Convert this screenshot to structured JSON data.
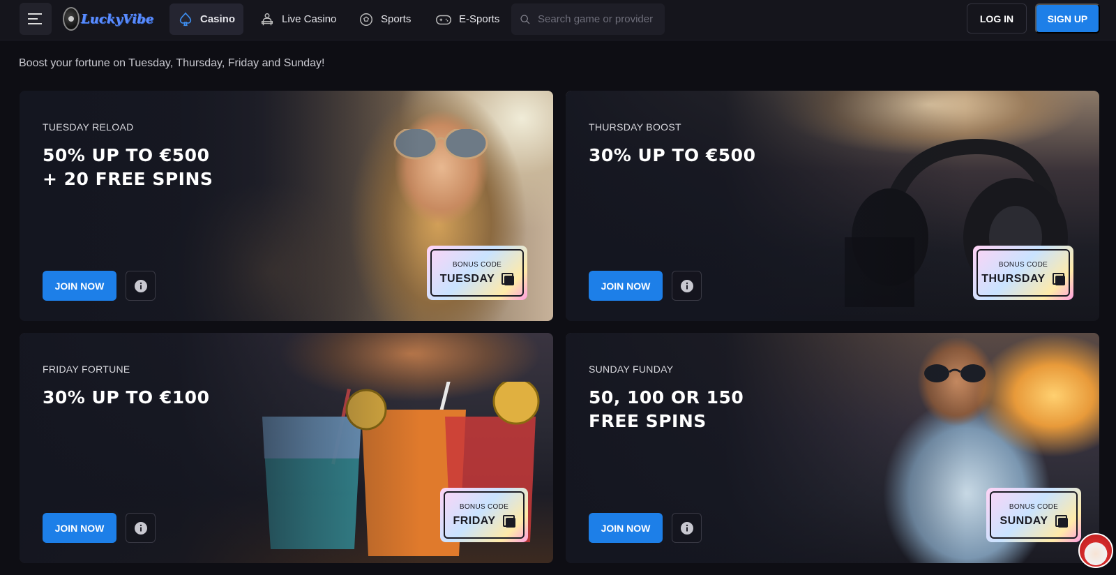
{
  "header": {
    "logo_text_a": "Lucky",
    "logo_text_b": "Vibe",
    "nav": [
      {
        "label": "Casino",
        "icon": "spade-icon",
        "active": true
      },
      {
        "label": "Live Casino",
        "icon": "dealer-icon",
        "active": false
      },
      {
        "label": "Sports",
        "icon": "soccer-ball-icon",
        "active": false
      },
      {
        "label": "E-Sports",
        "icon": "gamepad-icon",
        "active": false
      }
    ],
    "search_placeholder": "Search game or provider",
    "login_label": "LOG IN",
    "signup_label": "SIGN UP"
  },
  "subtitle": "Boost your fortune on Tuesday, Thursday, Friday and Sunday!",
  "promotions": [
    {
      "label": "TUESDAY RELOAD",
      "title_line1": "50% UP TO €500",
      "title_line2": "+ 20 FREE SPINS",
      "join_label": "JOIN NOW",
      "bonus_caption": "BONUS CODE",
      "bonus_code": "TUESDAY"
    },
    {
      "label": "THURSDAY BOOST",
      "title_line1": "30% UP TO €500",
      "title_line2": "",
      "join_label": "JOIN NOW",
      "bonus_caption": "BONUS CODE",
      "bonus_code": "THURSDAY"
    },
    {
      "label": "FRIDAY FORTUNE",
      "title_line1": "30% UP TO €100",
      "title_line2": "",
      "join_label": "JOIN NOW",
      "bonus_caption": "BONUS CODE",
      "bonus_code": "FRIDAY"
    },
    {
      "label": "SUNDAY FUNDAY",
      "title_line1": "50, 100 OR 150",
      "title_line2": "FREE SPINS",
      "join_label": "JOIN NOW",
      "bonus_caption": "BONUS CODE",
      "bonus_code": "SUNDAY"
    }
  ],
  "colors": {
    "accent": "#1d7fe8",
    "background": "#0e0e14",
    "header": "#15151c"
  }
}
